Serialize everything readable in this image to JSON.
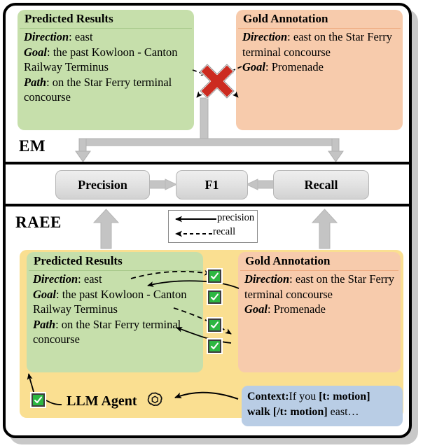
{
  "figure": {
    "sections": {
      "em_label": "EM",
      "raee_label": "RAEE"
    }
  },
  "em_block": {
    "predicted_card": {
      "title": "Predicted Results",
      "rows": [
        {
          "key": "Direction",
          "value": ": east"
        },
        {
          "key": "Goal",
          "value": ": the past Kowloon - Canton Railway Terminus"
        },
        {
          "key": "Path",
          "value": ": on the Star Ferry terminal concourse"
        }
      ]
    },
    "gold_card": {
      "title": "Gold Annotation",
      "rows": [
        {
          "key": "Direction",
          "value": ": east on the Star Ferry terminal concourse"
        },
        {
          "key": "Goal",
          "value": ": Promenade"
        }
      ]
    },
    "match_marker": "mismatch-x"
  },
  "metrics": {
    "precision": "Precision",
    "f1": "F1",
    "recall": "Recall"
  },
  "legend": {
    "items": [
      {
        "label": "precision",
        "style": "solid"
      },
      {
        "label": "recall",
        "style": "dashed"
      }
    ]
  },
  "raee_block": {
    "predicted_card": {
      "title": "Predicted Results",
      "rows": [
        {
          "key": "Direction",
          "value": ": east"
        },
        {
          "key": "Goal",
          "value": ": the past Kowloon - Canton Railway Terminus"
        },
        {
          "key": "Path",
          "value": ": on the Star Ferry terminal concourse"
        }
      ]
    },
    "gold_card": {
      "title": "Gold Annotation",
      "rows": [
        {
          "key": "Direction",
          "value": ": east on the Star Ferry terminal concourse"
        },
        {
          "key": "Goal",
          "value": ": Promenade"
        }
      ]
    },
    "agent": {
      "label": "LLM Agent",
      "logo": "openai-logo"
    },
    "context": {
      "label": "Context:",
      "line1_rest": "If you ",
      "line1_tag": "[t: motion]",
      "line2_tag": "walk [/t: motion]",
      "line2_rest": " east…"
    },
    "check_count": 5
  },
  "colors": {
    "green_card": "#c6dfab",
    "orange_card": "#f7cbac",
    "yellow_pane": "#fadf91",
    "blue_box": "#b9cde5",
    "check_green": "#2cb742",
    "x_red": "#cc2b20",
    "arrow_grey": "#c4c4c4"
  }
}
